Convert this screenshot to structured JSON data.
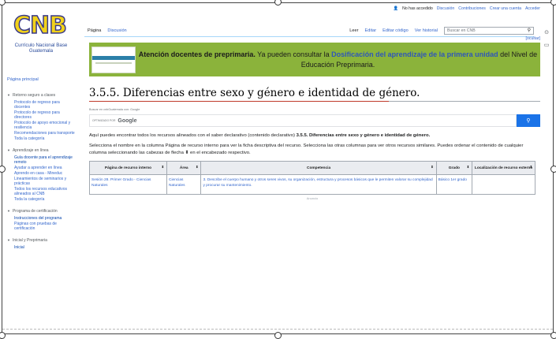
{
  "topbar": {
    "not_logged": "No has accedido",
    "discussion": "Discusión",
    "contributions": "Contribuciones",
    "create_account": "Crear una cuenta",
    "login": "Acceder"
  },
  "logo": {
    "text": "CNB",
    "subtitle": "Currículo Nacional Base Guatemala"
  },
  "sidebar": {
    "main_page": "Página principal",
    "sections": [
      {
        "title": "Retorno seguro a clases",
        "items": [
          "Protocolo de regreso para docentes",
          "Protocolo de regreso para directores",
          "Protocolo de apoyo emocional y resiliencia",
          "Recomendaciones para transporte",
          "Toda la categoría"
        ]
      },
      {
        "title": "Aprendizaje en línea",
        "items": [
          "Guía docente para el aprendizaje remoto",
          "Ayudar a aprender en línea",
          "Aprendo en casa - Mineduc",
          "Lineamientos de seminarios y prácticas",
          "Todos los recursos educativos alineados al CNB",
          "Toda la categoría"
        ]
      },
      {
        "title": "Programa de certificación",
        "items": [
          "Instrucciones del programa",
          "Páginas con pruebas de certificación"
        ]
      },
      {
        "title": "Inicial y Preprimaria",
        "items": [
          "Inicial"
        ]
      }
    ]
  },
  "tabs": {
    "page": "Página",
    "discussion": "Discusión",
    "read": "Leer",
    "edit": "Editar",
    "edit_source": "Editar código",
    "history": "Ver historial",
    "search_placeholder": "Buscar en CNB"
  },
  "content": {
    "hide_link": "[ocultar]",
    "banner_bold": "Atención docentes de preprimaria.",
    "banner_text": " Ya pueden consultar la ",
    "banner_link": "Dosificación del aprendizaje de la primera unidad",
    "banner_end": " del Nivel de Educación Preprimaria.",
    "title": "3.5.5. Diferencias entre sexo y género e identidad de género.",
    "cse_label": "Buscar en cnbGuatemala con: Google",
    "cse_powered": "OPTIMIZADO POR",
    "cse_google": "Google",
    "para1_pre": "Aquí puedes encontrar todos los recursos alineados con el saber declarativo (contenido declarativo) ",
    "para1_bold": "3.5.5. Diferencias entre sexo y género e identidad de género.",
    "para2": "Selecciona el nombre en la columna Página de recurso interno para ver la ficha descriptiva del recurso. Selecciona las otras columnas para ver otros recursos similares. Puedes ordenar el contenido de cualquier columna seleccionando las cabezas de flecha ⬍ en el encabezado respectivo."
  },
  "table": {
    "headers": [
      "Página de recurso interno",
      "Área",
      "Competencia",
      "Grado",
      "Localización de recurso externo"
    ],
    "rows": [
      {
        "page": "Sesión 28. Primer Grado - Ciencias Naturales",
        "area": "Ciencias Naturales",
        "competence": "3. Describe el cuerpo humano y otros seres vivos, su organización, estructura y procesos básicos que le permiten valorar su complejidad y procurar su mantenimiento.",
        "grade": "Básico 1er grado",
        "external": ""
      }
    ],
    "footer": "Anuncio"
  }
}
